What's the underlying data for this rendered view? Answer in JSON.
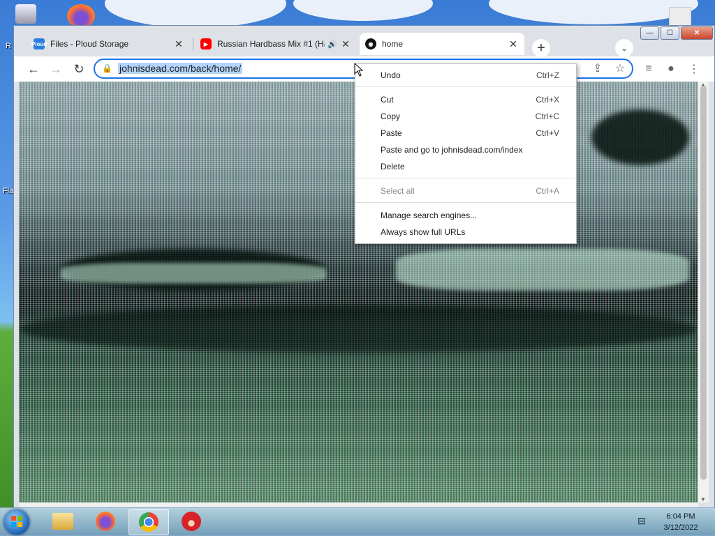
{
  "desktop": {
    "icon_label_1": "R",
    "icon_label_2": "Fla"
  },
  "window": {
    "controls": {
      "minimize": "—",
      "maximize": "☐",
      "close": "✕"
    }
  },
  "tabs": [
    {
      "title": "Files - Ploud Storage",
      "favicon": "ploud-icon",
      "favicon_text": "Ploud",
      "favicon_color": "#2a7de1"
    },
    {
      "title": "Russian Hardbass Mix #1 (Ha",
      "favicon": "youtube-icon",
      "favicon_color": "#ff0000",
      "audio_icon": "🔊"
    },
    {
      "title": "home",
      "favicon": "home-site-icon",
      "favicon_color": "#111111"
    }
  ],
  "tab_close_glyph": "✕",
  "new_tab_glyph": "+",
  "tab_search_glyph": "⌄",
  "toolbar": {
    "back_glyph": "←",
    "forward_glyph": "→",
    "reload_glyph": "↻",
    "lock_glyph": "🔒",
    "url": "johnisdead.com/back/home/",
    "share_glyph": "⇪",
    "bookmark_glyph": "☆",
    "media_glyph": "≡",
    "profile_glyph": "●",
    "menu_glyph": "⋮"
  },
  "context_menu": {
    "items": [
      {
        "label": "Undo",
        "shortcut": "Ctrl+Z",
        "disabled": false
      },
      {
        "label": "Cut",
        "shortcut": "Ctrl+X",
        "disabled": false
      },
      {
        "label": "Copy",
        "shortcut": "Ctrl+C",
        "disabled": false
      },
      {
        "label": "Paste",
        "shortcut": "Ctrl+V",
        "disabled": false
      },
      {
        "label": "Paste and go to johnisdead.com/index",
        "shortcut": "",
        "disabled": false
      },
      {
        "label": "Delete",
        "shortcut": "",
        "disabled": false
      },
      {
        "label": "Select all",
        "shortcut": "Ctrl+A",
        "disabled": true
      },
      {
        "label": "Manage search engines...",
        "shortcut": "",
        "disabled": false
      },
      {
        "label": "Always show full URLs",
        "shortcut": "",
        "disabled": false
      }
    ]
  },
  "scrollbar": {
    "up": "▲",
    "down": "▼"
  },
  "taskbar": {
    "apps": [
      "file-explorer-icon",
      "firefox-icon",
      "chrome-icon",
      "angry-birds-icon"
    ],
    "active_app": "chrome-icon",
    "network_glyph": "⊟",
    "time": "6:04 PM",
    "date": "3/12/2022"
  },
  "colors": {
    "accent": "#1a73e8",
    "url_selection": "#b3d4fc"
  }
}
